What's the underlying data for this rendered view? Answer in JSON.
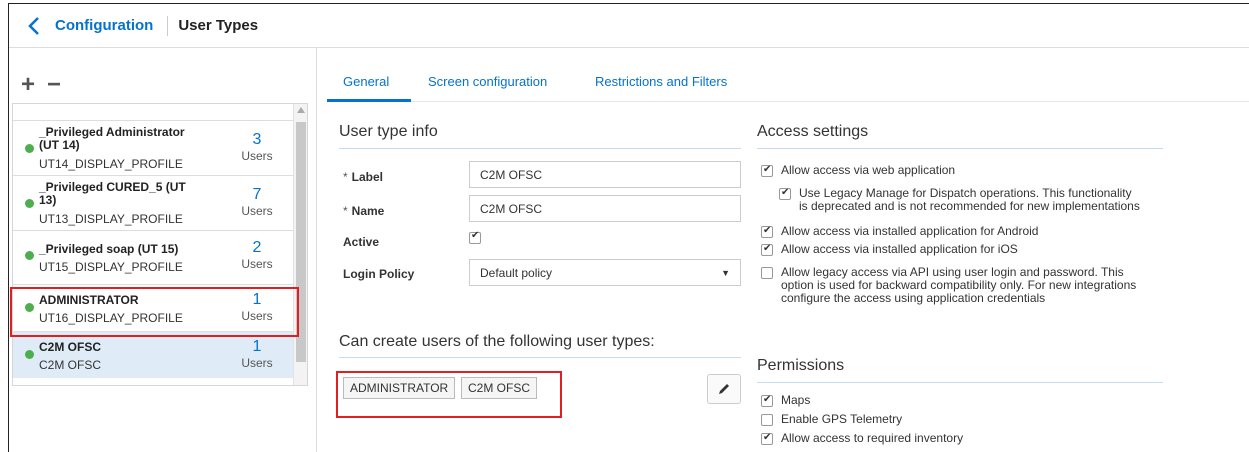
{
  "header": {
    "back_icon": "chevron-left-icon",
    "breadcrumb": "Configuration",
    "title": "User Types"
  },
  "toolbar": {
    "add_label": "+",
    "remove_label": "−"
  },
  "user_types": [
    {
      "name_line1": "_Privileged Administrator",
      "name_line2": "(UT 14)",
      "profile": "UT14_DISPLAY_PROFILE",
      "count": "3",
      "unit": "Users",
      "status": "active"
    },
    {
      "name_line1": "_Privileged CURED_5 (UT",
      "name_line2": "13)",
      "profile": "UT13_DISPLAY_PROFILE",
      "count": "7",
      "unit": "Users",
      "status": "active"
    },
    {
      "name_line1": "_Privileged soap (UT 15)",
      "name_line2": "",
      "profile": "UT15_DISPLAY_PROFILE",
      "count": "2",
      "unit": "Users",
      "status": "active"
    },
    {
      "name_line1": "ADMINISTRATOR",
      "name_line2": "",
      "profile": "UT16_DISPLAY_PROFILE",
      "count": "1",
      "unit": "Users",
      "status": "active"
    },
    {
      "name_line1": "C2M OFSC",
      "name_line2": "",
      "profile": "C2M OFSC",
      "count": "1",
      "unit": "Users",
      "status": "active",
      "selected": true
    }
  ],
  "tabs": [
    {
      "label": "General",
      "active": true
    },
    {
      "label": "Screen configuration"
    },
    {
      "label": "Restrictions and Filters"
    }
  ],
  "user_type_info": {
    "title": "User type info",
    "label_field": {
      "label": "Label",
      "value": "C2M OFSC",
      "required": "*"
    },
    "name_field": {
      "label": "Name",
      "value": "C2M OFSC",
      "required": "*"
    },
    "active": {
      "label": "Active",
      "checked": true
    },
    "login_policy": {
      "label": "Login Policy",
      "value": "Default policy"
    }
  },
  "can_create": {
    "title": "Can create users of the following user types:",
    "chips": [
      "ADMINISTRATOR",
      "C2M OFSC"
    ],
    "edit_icon": "pencil-icon"
  },
  "access_settings": {
    "title": "Access settings",
    "items": [
      {
        "lines": [
          "Allow access via web application"
        ],
        "checked": true
      },
      {
        "lines": [
          "Use Legacy Manage for Dispatch operations. This functionality",
          "is deprecated and is not recommended for new implementations"
        ],
        "checked": true
      },
      {
        "lines": [
          "Allow access via installed application for Android"
        ],
        "checked": true
      },
      {
        "lines": [
          "Allow access via installed application for iOS"
        ],
        "checked": true
      },
      {
        "lines": [
          "Allow legacy access via API using user login and password. This",
          "option is used for backward compatibility only. For new integrations",
          "configure the access using application credentials"
        ],
        "checked": false
      }
    ]
  },
  "permissions": {
    "title": "Permissions",
    "items": [
      {
        "label": "Maps",
        "checked": true
      },
      {
        "label": "Enable GPS Telemetry",
        "checked": false
      },
      {
        "label": "Allow access to required inventory",
        "checked": true
      }
    ]
  },
  "colors": {
    "accent": "#0572ce",
    "status_active": "#4cae4c",
    "selected_row": "#dfecf7",
    "highlight": "#e02020"
  }
}
